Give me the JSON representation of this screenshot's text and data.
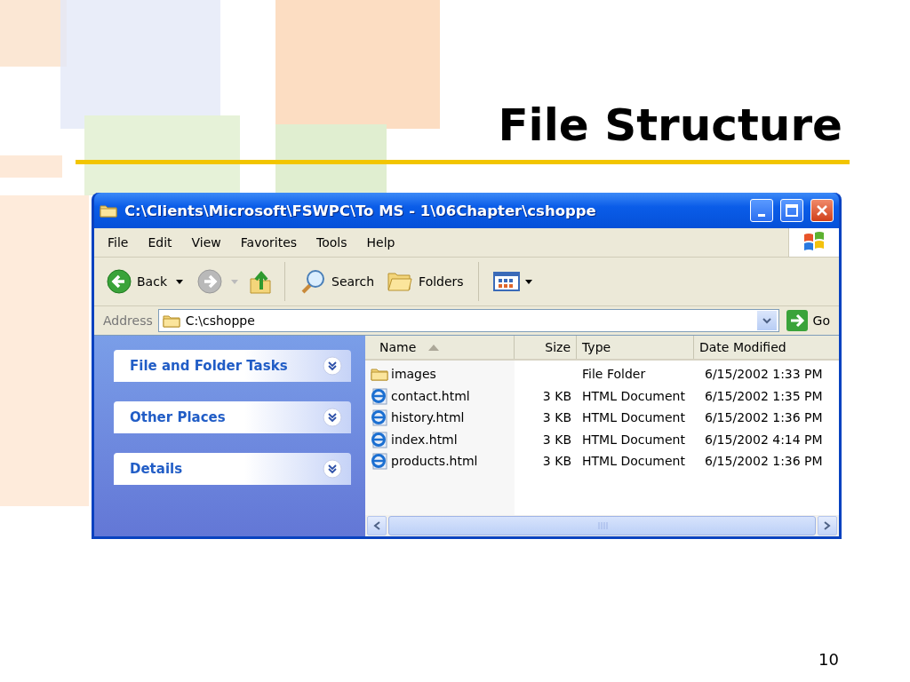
{
  "slide": {
    "title": "File Structure",
    "page_number": "10"
  },
  "window": {
    "title": "C:\\Clients\\Microsoft\\FSWPC\\To MS - 1\\06Chapter\\cshoppe"
  },
  "menu": [
    "File",
    "Edit",
    "View",
    "Favorites",
    "Tools",
    "Help"
  ],
  "toolbar": [
    {
      "kind": "back",
      "label": "Back"
    },
    {
      "kind": "forward"
    },
    {
      "kind": "up"
    },
    {
      "kind": "search",
      "label": "Search"
    },
    {
      "kind": "folders",
      "label": "Folders"
    },
    {
      "kind": "views"
    }
  ],
  "address": {
    "label": "Address",
    "value": "C:\\cshoppe",
    "go": "Go"
  },
  "task_panes": [
    {
      "title": "File and Folder Tasks",
      "expanded": false
    },
    {
      "title": "Other Places",
      "expanded": false
    },
    {
      "title": "Details",
      "expanded": false
    }
  ],
  "table": {
    "columns": [
      {
        "label": "Name",
        "sorted": true
      },
      {
        "label": "Size",
        "sorted": false
      },
      {
        "label": "Type",
        "sorted": false
      },
      {
        "label": "Date Modified",
        "sorted": false
      }
    ],
    "rows": [
      {
        "kind": "folder",
        "name": "images",
        "type": "File Folder",
        "date": "6/15/2002 1:33 PM"
      },
      {
        "kind": "web",
        "name": "contact.html",
        "size": "3 KB",
        "type": "HTML Document",
        "date": "6/15/2002 1:35 PM"
      },
      {
        "kind": "web",
        "name": "history.html",
        "size": "3 KB",
        "type": "HTML Document",
        "date": "6/15/2002 1:36 PM"
      },
      {
        "kind": "web",
        "name": "index.html",
        "size": "3 KB",
        "type": "HTML Document",
        "date": "6/15/2002 4:14 PM"
      },
      {
        "kind": "web",
        "name": "products.html",
        "size": "3 KB",
        "type": "HTML Document",
        "date": "6/15/2002 1:36 PM"
      }
    ]
  }
}
